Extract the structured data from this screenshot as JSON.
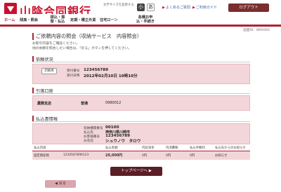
{
  "header": {
    "brand": "山陰合同銀行",
    "fontsize_label": "文字サイズを変更する",
    "fs_small": "小",
    "fs_large": "あ",
    "faq": "よくあるご質問",
    "help": "ご利用ガイド",
    "logout": "ログアウト"
  },
  "nav": {
    "items": [
      {
        "label": "ホーム"
      },
      {
        "label": "残高・照会"
      },
      {
        "label": "振込・振替・払込"
      },
      {
        "label": "定期・積立"
      },
      {
        "label": "外貨"
      },
      {
        "label": "住宅ローン"
      },
      {
        "label": "各種お申込・手続き"
      }
    ]
  },
  "page": {
    "screen_id": "画面ID：BMV064",
    "title": "ご依頼内容の照会（収納サービス　内容照会）",
    "desc1": "お取引内容をご確認ください。",
    "desc2": "他の依頼を照会したい場合は、「戻る」ボタンを押してください。"
  },
  "sections": {
    "request": {
      "title": "依頼状況",
      "print": "印刷用",
      "receipt_label": "受付番号",
      "receipt_value": "123456789",
      "datetime_label": "受付日時",
      "datetime_value": "2012年02月10日 10時10分"
    },
    "account": {
      "title": "引落口座",
      "branch": "農務支店",
      "type": "普通",
      "number": "0980012"
    },
    "payment": {
      "title": "払込書情報",
      "rows": [
        {
          "label": "収納機関番号",
          "value": "00100"
        },
        {
          "label": "払込先",
          "value": "神奈川県川崎市"
        },
        {
          "label": "お客様番号",
          "value": "123456789"
        },
        {
          "label": "お名前",
          "value": "シュウノウ　タロウ"
        }
      ]
    }
  },
  "table": {
    "headers": [
      "払込内容",
      "",
      "払込金額",
      "内延滞金",
      "内消費税",
      "払込手数料",
      "払込先からのお知らせ"
    ],
    "rows": [
      [
        "固定資産税",
        "1234567890123",
        "20,000円",
        "0円",
        "0円",
        "0円",
        "お知らせ"
      ]
    ]
  },
  "buttons": {
    "top": "トップページへ",
    "back": "戻る"
  }
}
